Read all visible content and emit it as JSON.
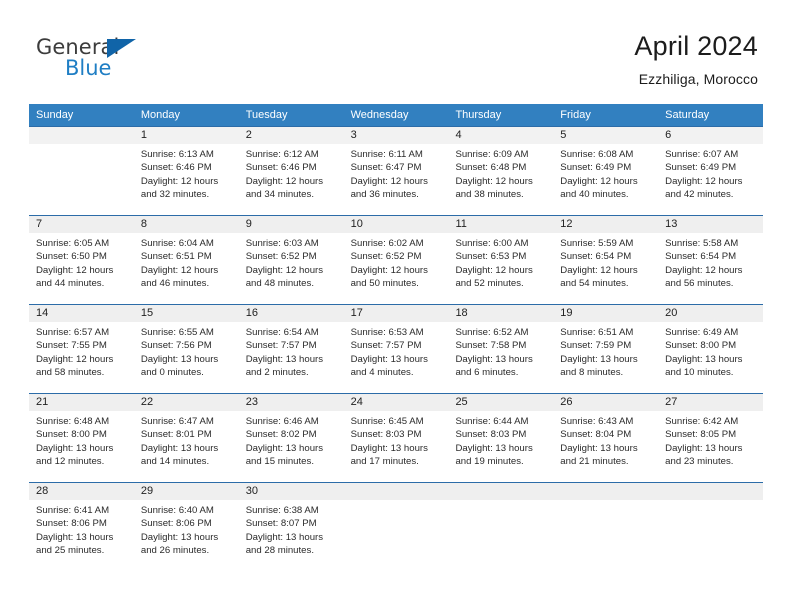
{
  "logo": {
    "word_top": "General",
    "word_bottom": "Blue",
    "triangle_color": "#1064a8",
    "blue_color": "#1f7ec4"
  },
  "header": {
    "title": "April 2024",
    "subtitle": "Ezzhiliga, Morocco"
  },
  "theme": {
    "header_blue": "#3280c0",
    "rule_blue": "#2c6ca8",
    "date_band_gray": "#efefef",
    "text": "#222222"
  },
  "weekdays": [
    "Sunday",
    "Monday",
    "Tuesday",
    "Wednesday",
    "Thursday",
    "Friday",
    "Saturday"
  ],
  "weeks": [
    {
      "days": [
        {
          "date": "",
          "lines": []
        },
        {
          "date": "1",
          "lines": [
            "Sunrise: 6:13 AM",
            "Sunset: 6:46 PM",
            "Daylight: 12 hours",
            "and 32 minutes."
          ]
        },
        {
          "date": "2",
          "lines": [
            "Sunrise: 6:12 AM",
            "Sunset: 6:46 PM",
            "Daylight: 12 hours",
            "and 34 minutes."
          ]
        },
        {
          "date": "3",
          "lines": [
            "Sunrise: 6:11 AM",
            "Sunset: 6:47 PM",
            "Daylight: 12 hours",
            "and 36 minutes."
          ]
        },
        {
          "date": "4",
          "lines": [
            "Sunrise: 6:09 AM",
            "Sunset: 6:48 PM",
            "Daylight: 12 hours",
            "and 38 minutes."
          ]
        },
        {
          "date": "5",
          "lines": [
            "Sunrise: 6:08 AM",
            "Sunset: 6:49 PM",
            "Daylight: 12 hours",
            "and 40 minutes."
          ]
        },
        {
          "date": "6",
          "lines": [
            "Sunrise: 6:07 AM",
            "Sunset: 6:49 PM",
            "Daylight: 12 hours",
            "and 42 minutes."
          ]
        }
      ]
    },
    {
      "days": [
        {
          "date": "7",
          "lines": [
            "Sunrise: 6:05 AM",
            "Sunset: 6:50 PM",
            "Daylight: 12 hours",
            "and 44 minutes."
          ]
        },
        {
          "date": "8",
          "lines": [
            "Sunrise: 6:04 AM",
            "Sunset: 6:51 PM",
            "Daylight: 12 hours",
            "and 46 minutes."
          ]
        },
        {
          "date": "9",
          "lines": [
            "Sunrise: 6:03 AM",
            "Sunset: 6:52 PM",
            "Daylight: 12 hours",
            "and 48 minutes."
          ]
        },
        {
          "date": "10",
          "lines": [
            "Sunrise: 6:02 AM",
            "Sunset: 6:52 PM",
            "Daylight: 12 hours",
            "and 50 minutes."
          ]
        },
        {
          "date": "11",
          "lines": [
            "Sunrise: 6:00 AM",
            "Sunset: 6:53 PM",
            "Daylight: 12 hours",
            "and 52 minutes."
          ]
        },
        {
          "date": "12",
          "lines": [
            "Sunrise: 5:59 AM",
            "Sunset: 6:54 PM",
            "Daylight: 12 hours",
            "and 54 minutes."
          ]
        },
        {
          "date": "13",
          "lines": [
            "Sunrise: 5:58 AM",
            "Sunset: 6:54 PM",
            "Daylight: 12 hours",
            "and 56 minutes."
          ]
        }
      ]
    },
    {
      "days": [
        {
          "date": "14",
          "lines": [
            "Sunrise: 6:57 AM",
            "Sunset: 7:55 PM",
            "Daylight: 12 hours",
            "and 58 minutes."
          ]
        },
        {
          "date": "15",
          "lines": [
            "Sunrise: 6:55 AM",
            "Sunset: 7:56 PM",
            "Daylight: 13 hours",
            "and 0 minutes."
          ]
        },
        {
          "date": "16",
          "lines": [
            "Sunrise: 6:54 AM",
            "Sunset: 7:57 PM",
            "Daylight: 13 hours",
            "and 2 minutes."
          ]
        },
        {
          "date": "17",
          "lines": [
            "Sunrise: 6:53 AM",
            "Sunset: 7:57 PM",
            "Daylight: 13 hours",
            "and 4 minutes."
          ]
        },
        {
          "date": "18",
          "lines": [
            "Sunrise: 6:52 AM",
            "Sunset: 7:58 PM",
            "Daylight: 13 hours",
            "and 6 minutes."
          ]
        },
        {
          "date": "19",
          "lines": [
            "Sunrise: 6:51 AM",
            "Sunset: 7:59 PM",
            "Daylight: 13 hours",
            "and 8 minutes."
          ]
        },
        {
          "date": "20",
          "lines": [
            "Sunrise: 6:49 AM",
            "Sunset: 8:00 PM",
            "Daylight: 13 hours",
            "and 10 minutes."
          ]
        }
      ]
    },
    {
      "days": [
        {
          "date": "21",
          "lines": [
            "Sunrise: 6:48 AM",
            "Sunset: 8:00 PM",
            "Daylight: 13 hours",
            "and 12 minutes."
          ]
        },
        {
          "date": "22",
          "lines": [
            "Sunrise: 6:47 AM",
            "Sunset: 8:01 PM",
            "Daylight: 13 hours",
            "and 14 minutes."
          ]
        },
        {
          "date": "23",
          "lines": [
            "Sunrise: 6:46 AM",
            "Sunset: 8:02 PM",
            "Daylight: 13 hours",
            "and 15 minutes."
          ]
        },
        {
          "date": "24",
          "lines": [
            "Sunrise: 6:45 AM",
            "Sunset: 8:03 PM",
            "Daylight: 13 hours",
            "and 17 minutes."
          ]
        },
        {
          "date": "25",
          "lines": [
            "Sunrise: 6:44 AM",
            "Sunset: 8:03 PM",
            "Daylight: 13 hours",
            "and 19 minutes."
          ]
        },
        {
          "date": "26",
          "lines": [
            "Sunrise: 6:43 AM",
            "Sunset: 8:04 PM",
            "Daylight: 13 hours",
            "and 21 minutes."
          ]
        },
        {
          "date": "27",
          "lines": [
            "Sunrise: 6:42 AM",
            "Sunset: 8:05 PM",
            "Daylight: 13 hours",
            "and 23 minutes."
          ]
        }
      ]
    },
    {
      "days": [
        {
          "date": "28",
          "lines": [
            "Sunrise: 6:41 AM",
            "Sunset: 8:06 PM",
            "Daylight: 13 hours",
            "and 25 minutes."
          ]
        },
        {
          "date": "29",
          "lines": [
            "Sunrise: 6:40 AM",
            "Sunset: 8:06 PM",
            "Daylight: 13 hours",
            "and 26 minutes."
          ]
        },
        {
          "date": "30",
          "lines": [
            "Sunrise: 6:38 AM",
            "Sunset: 8:07 PM",
            "Daylight: 13 hours",
            "and 28 minutes."
          ]
        },
        {
          "date": "",
          "lines": []
        },
        {
          "date": "",
          "lines": []
        },
        {
          "date": "",
          "lines": []
        },
        {
          "date": "",
          "lines": []
        }
      ]
    }
  ]
}
